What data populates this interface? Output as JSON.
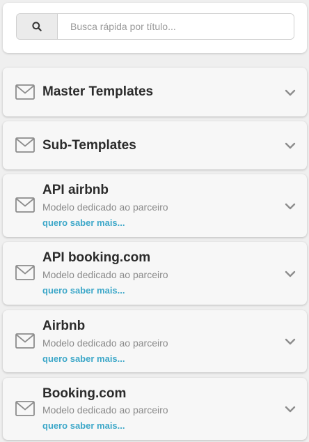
{
  "search": {
    "placeholder": "Busca rápida por título..."
  },
  "sections": [
    {
      "title": "Master Templates"
    },
    {
      "title": "Sub-Templates"
    },
    {
      "title": "API airbnb",
      "subtitle": "Modelo dedicado ao parceiro",
      "link": "quero saber mais..."
    },
    {
      "title": "API booking.com",
      "subtitle": "Modelo dedicado ao parceiro",
      "link": "quero saber mais..."
    },
    {
      "title": "Airbnb",
      "subtitle": "Modelo dedicado ao parceiro",
      "link": "quero saber mais..."
    },
    {
      "title": "Booking.com",
      "subtitle": "Modelo dedicado ao parceiro",
      "link": "quero saber mais..."
    }
  ],
  "colors": {
    "link": "#3ea8c9",
    "icon": "#8c8c8c",
    "background": "#efefef"
  }
}
